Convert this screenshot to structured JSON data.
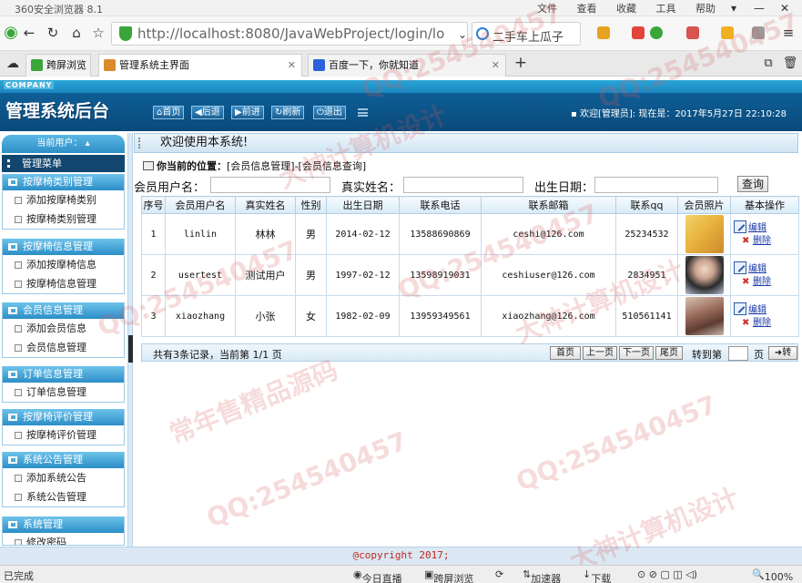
{
  "browser": {
    "window_title": "360安全浏览器 8.1",
    "window_menu": [
      "文件",
      "查看",
      "收藏",
      "工具",
      "帮助"
    ],
    "url": "http://localhost:8080/JavaWebProject/login/lo",
    "search_text": "二手车上瓜子",
    "tabs": [
      {
        "label": "跨屏浏览",
        "active": false
      },
      {
        "label": "管理系统主界面",
        "active": true
      },
      {
        "label": "百度一下，你就知道",
        "active": false
      }
    ]
  },
  "header": {
    "company": "COMPANY",
    "system_title": "管理系统后台",
    "buttons": [
      "首页",
      "后退",
      "前进",
      "刷新",
      "退出"
    ],
    "welcome_text": "欢迎[管理员]:   现在是：2017年5月27日  22:10:28"
  },
  "sidebar": {
    "current_user_label": "当前用户：",
    "menu_title": "管理菜单",
    "groups": [
      {
        "title": "按摩椅类别管理",
        "items": [
          "添加按摩椅类别",
          "按摩椅类别管理"
        ]
      },
      {
        "title": "按摩椅信息管理",
        "items": [
          "添加按摩椅信息",
          "按摩椅信息管理"
        ]
      },
      {
        "title": "会员信息管理",
        "items": [
          "添加会员信息",
          "会员信息管理"
        ]
      },
      {
        "title": "订单信息管理",
        "items": [
          "订单信息管理"
        ]
      },
      {
        "title": "按摩椅评价管理",
        "items": [
          "按摩椅评价管理"
        ]
      },
      {
        "title": "系统公告管理",
        "items": [
          "添加系统公告",
          "系统公告管理"
        ]
      },
      {
        "title": "系统管理",
        "items": [
          "修改密码"
        ]
      }
    ]
  },
  "main": {
    "welcome": "欢迎使用本系统!",
    "location_label": "你当前的位置：",
    "location_path": "[会员信息管理]-[会员信息查询]",
    "search": {
      "username_label": "会员用户名：",
      "realname_label": "真实姓名：",
      "birthday_label": "出生日期：",
      "query_button": "查询"
    },
    "table": {
      "columns": [
        "序号",
        "会员用户名",
        "真实姓名",
        "性别",
        "出生日期",
        "联系电话",
        "联系邮箱",
        "联系qq",
        "会员照片",
        "基本操作"
      ],
      "rows": [
        {
          "no": "1",
          "username": "linlin",
          "realname": "林林",
          "gender": "男",
          "birthday": "2014-02-12",
          "phone": "13588690869",
          "email": "ceshi@126.com",
          "qq": "25234532"
        },
        {
          "no": "2",
          "username": "usertest",
          "realname": "测试用户",
          "gender": "男",
          "birthday": "1997-02-12",
          "phone": "13598919031",
          "email": "ceshiuser@126.com",
          "qq": "2834951"
        },
        {
          "no": "3",
          "username": "xiaozhang",
          "realname": "小张",
          "gender": "女",
          "birthday": "1982-02-09",
          "phone": "13959349561",
          "email": "xiaozhang@126.com",
          "qq": "510561141"
        }
      ],
      "edit_label": "编辑",
      "delete_label": "删除"
    },
    "pager": {
      "summary": "共有3条记录，当前第 1/1 页",
      "buttons": [
        "首页",
        "上一页",
        "下一页",
        "尾页"
      ],
      "goto_label": "转到第",
      "page_unit": "页",
      "go_button": "转"
    },
    "copyright": "@copyright 2017;"
  },
  "statusbar": {
    "left": "已完成",
    "items": [
      "今日直播",
      "跨屏浏览",
      "加速器",
      "下载"
    ],
    "zoom": "100%"
  },
  "watermark": [
    "QQ:254540457",
    "大神计算机设计",
    "常年售精品源码"
  ],
  "colors": {
    "header_dark": "#0a4a7a",
    "header_light": "#2aa6d8",
    "copyright_red": "#c0281e",
    "link_blue": "#1a3aa8"
  }
}
